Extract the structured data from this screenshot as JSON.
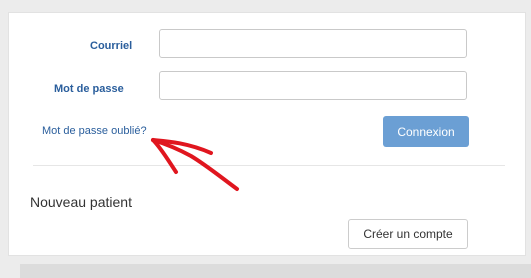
{
  "login_form": {
    "email_label": "Courriel",
    "email_value": "",
    "password_label": "Mot de passe",
    "password_value": "",
    "forgot_password_link": "Mot de passe oublié?",
    "login_button": "Connexion"
  },
  "new_patient": {
    "title": "Nouveau patient",
    "create_account_button": "Créer un compte"
  },
  "colors": {
    "link": "#2a5e9c",
    "primary_button": "#6b9fd4",
    "annotation_arrow": "#e0161f"
  },
  "annotation": {
    "icon": "red-hand-drawn-arrow-icon"
  }
}
